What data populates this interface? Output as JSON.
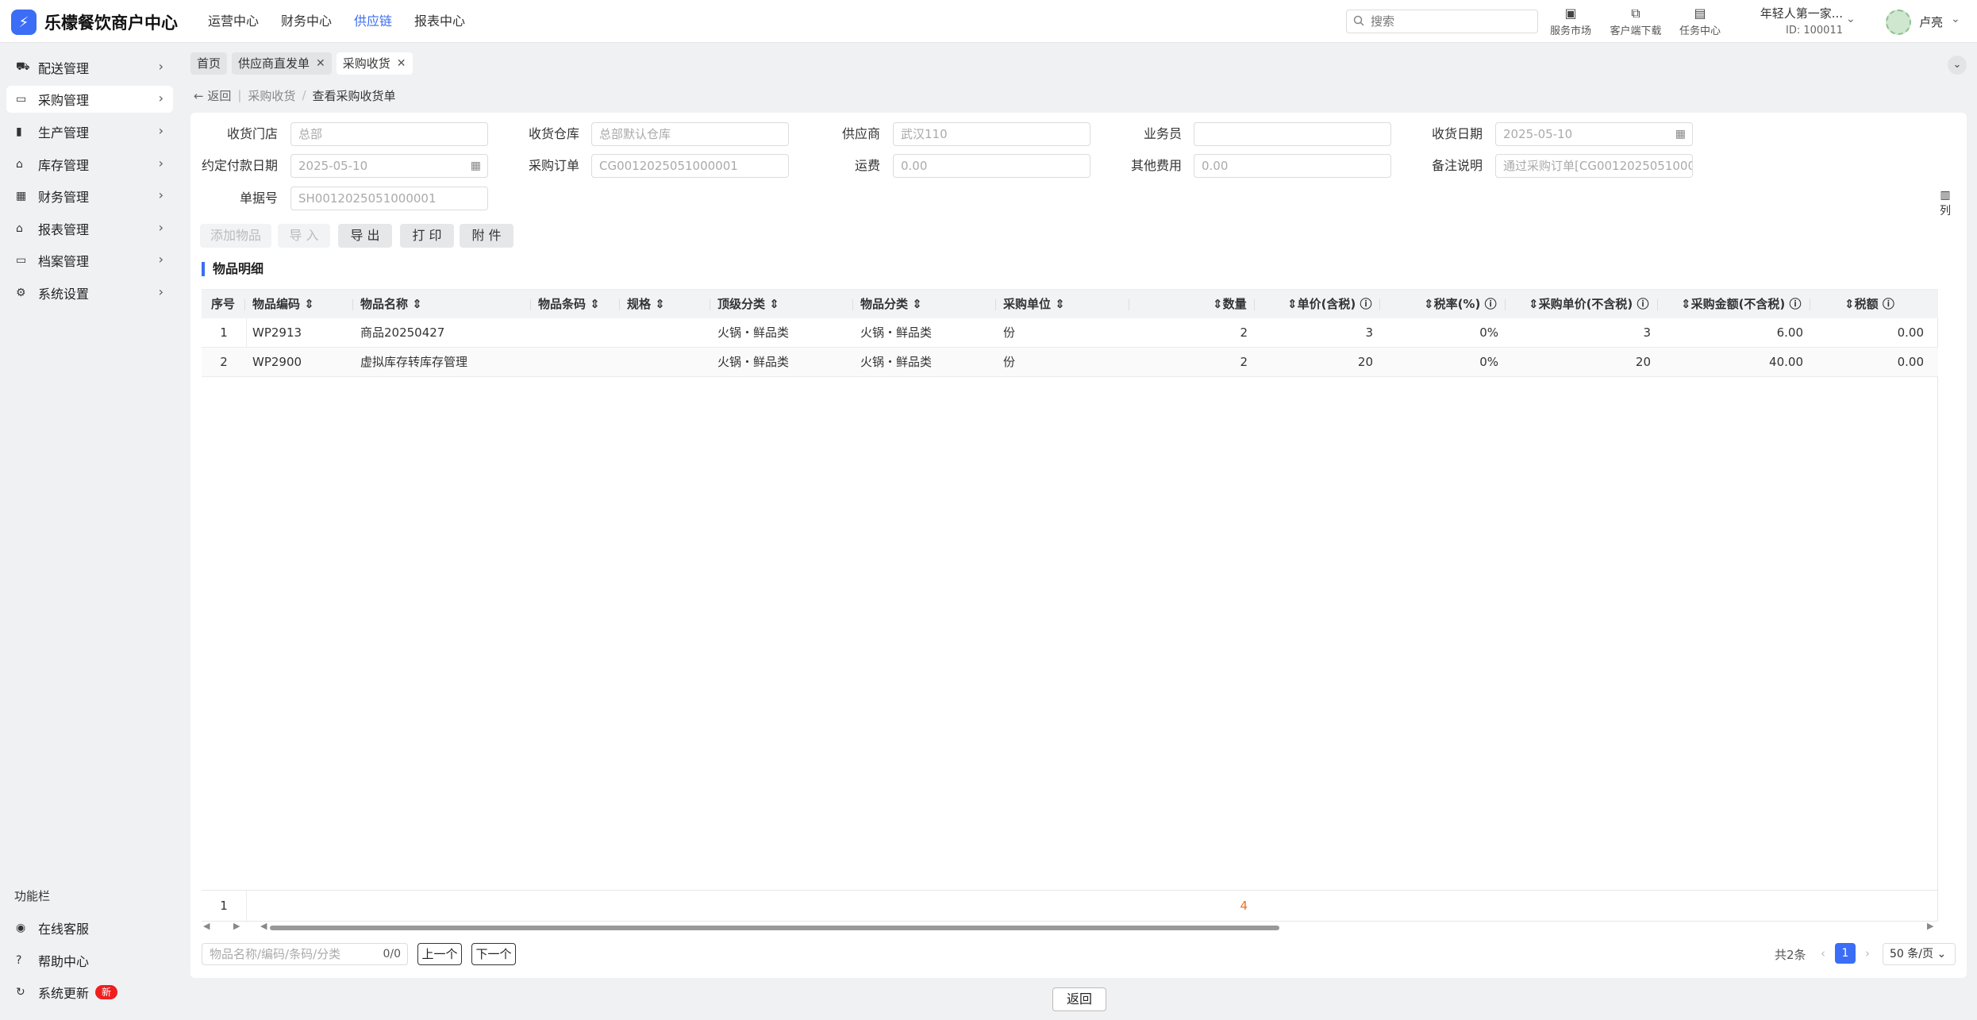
{
  "app": {
    "title": "乐檬餐饮商户中心",
    "logo_icon": "logo-icon"
  },
  "topnav": [
    {
      "label": "运营中心",
      "active": false
    },
    {
      "label": "财务中心",
      "active": false
    },
    {
      "label": "供应链",
      "active": true
    },
    {
      "label": "报表中心",
      "active": false
    }
  ],
  "search": {
    "placeholder": "搜索"
  },
  "tools": [
    {
      "label": "服务市场",
      "icon": "shop-icon"
    },
    {
      "label": "客户端下载",
      "icon": "folder-download-icon"
    },
    {
      "label": "任务中心",
      "icon": "clipboard-icon"
    }
  ],
  "user": {
    "company": "年轻人第一家...",
    "id": "ID: 100011",
    "name": "卢亮"
  },
  "sidebar": {
    "items": [
      {
        "label": "配送管理",
        "icon": "truck-icon"
      },
      {
        "label": "采购管理",
        "icon": "inbox-icon"
      },
      {
        "label": "生产管理",
        "icon": "bar-chart-icon"
      },
      {
        "label": "库存管理",
        "icon": "warehouse-icon"
      },
      {
        "label": "财务管理",
        "icon": "finance-icon"
      },
      {
        "label": "报表管理",
        "icon": "store-icon"
      },
      {
        "label": "档案管理",
        "icon": "archive-icon"
      },
      {
        "label": "系统设置",
        "icon": "gear-icon"
      }
    ],
    "function_title": "功能栏",
    "functions": [
      {
        "label": "在线客服",
        "icon": "headset-icon"
      },
      {
        "label": "帮助中心",
        "icon": "help-icon"
      },
      {
        "label": "系统更新",
        "icon": "refresh-icon",
        "badge": "新"
      }
    ]
  },
  "tabs": [
    {
      "label": "首页",
      "closable": false
    },
    {
      "label": "供应商直发单",
      "closable": true
    },
    {
      "label": "采购收货",
      "closable": true
    }
  ],
  "breadcrumb": {
    "back": "返回",
    "parent": "采购收货",
    "current": "查看采购收货单"
  },
  "form": {
    "fields": [
      {
        "label": "收货门店",
        "value": "总部"
      },
      {
        "label": "收货仓库",
        "value": "总部默认仓库"
      },
      {
        "label": "供应商",
        "value": "武汉110"
      },
      {
        "label": "业务员",
        "value": ""
      },
      {
        "label": "收货日期",
        "value": "2025-05-10"
      },
      {
        "label": "约定付款日期",
        "value": "2025-05-10"
      },
      {
        "label": "采购订单",
        "value": "CG0012025051000001"
      },
      {
        "label": "运费",
        "value": "0.00"
      },
      {
        "label": "其他费用",
        "value": "0.00"
      },
      {
        "label": "备注说明",
        "value": "通过采购订单[CG0012025051000"
      },
      {
        "label": "单据号",
        "value": "SH0012025051000001"
      }
    ]
  },
  "actions": {
    "add_item": "添加物品",
    "import": "导 入",
    "export": "导 出",
    "print": "打 印",
    "attachment": "附 件"
  },
  "section_title": "物品明细",
  "table": {
    "headers": [
      "序号",
      "物品编码",
      "物品名称",
      "物品条码",
      "规格",
      "顶级分类",
      "物品分类",
      "采购单位",
      "数量",
      "单价(含税)",
      "税率(%)",
      "采购单价(不含税)",
      "采购金额(不含税)",
      "税额"
    ],
    "rows": [
      {
        "index": "1",
        "code": "WP2913",
        "name": "商品20250427",
        "barcode": "",
        "spec": "",
        "top_category": "火锅・鲜品类",
        "category": "火锅・鲜品类",
        "unit": "份",
        "qty": "2",
        "price_tax": "3",
        "tax_rate": "0%",
        "price_notax": "3",
        "amount_notax": "6.00",
        "tax": "0.00"
      },
      {
        "index": "2",
        "code": "WP2900",
        "name": "虚拟库存转库存管理",
        "barcode": "",
        "spec": "",
        "top_category": "火锅・鲜品类",
        "category": "火锅・鲜品类",
        "unit": "份",
        "qty": "2",
        "price_tax": "20",
        "tax_rate": "0%",
        "price_notax": "20",
        "amount_notax": "40.00",
        "tax": "0.00"
      }
    ],
    "summary": {
      "index": "1",
      "qty": "4"
    },
    "column_settings": "列"
  },
  "find": {
    "placeholder": "物品名称/编码/条码/分类",
    "count": "0/0",
    "prev": "上一个",
    "next": "下一个"
  },
  "pager": {
    "total": "共2条",
    "page": "1",
    "size": "50 条/页"
  },
  "footer": {
    "back": "返回"
  },
  "colors": {
    "accent": "#3b6df6",
    "badge": "#f01e1e",
    "summary_qty": "#e8702a"
  }
}
